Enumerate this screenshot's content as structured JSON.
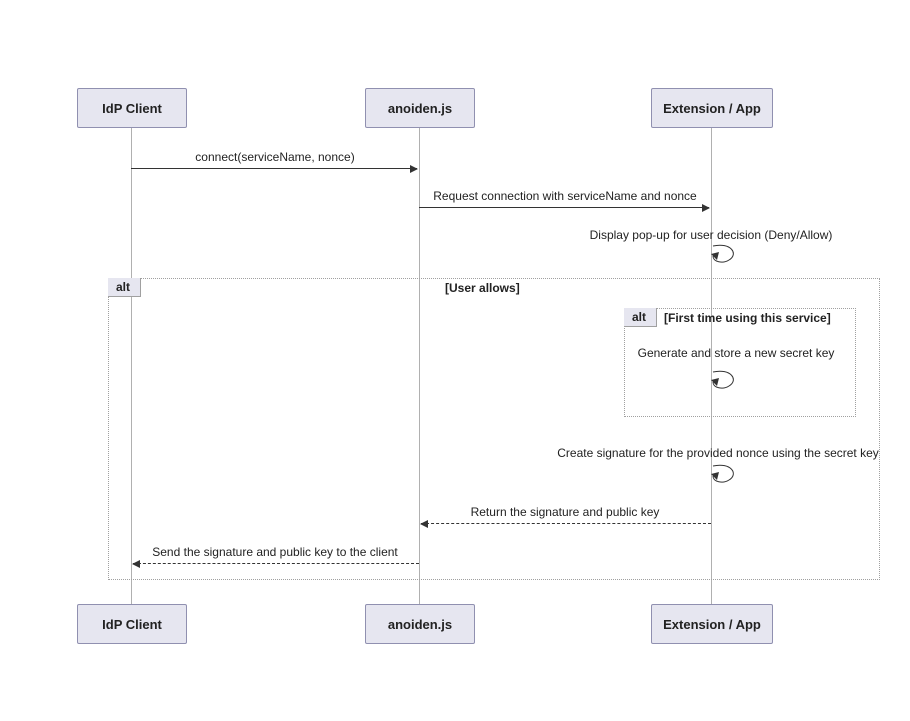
{
  "participants": {
    "p1": "IdP Client",
    "p2": "anoiden.js",
    "p3": "Extension / App"
  },
  "messages": {
    "m1": "connect(serviceName, nonce)",
    "m2": "Request connection with serviceName and nonce",
    "m3": "Display pop-up for user decision (Deny/Allow)",
    "m4": "Generate and store a new secret key",
    "m5": "Create signature for the provided nonce using the secret key",
    "m6": "Return the signature and public key",
    "m7": "Send the signature and public key to the client"
  },
  "alt": {
    "outer_label": "alt",
    "outer_cond": "[User allows]",
    "inner_label": "alt",
    "inner_cond": "[First time using this service]"
  },
  "chart_data": {
    "type": "sequence_diagram",
    "participants": [
      "IdP Client",
      "anoiden.js",
      "Extension / App"
    ],
    "messages": [
      {
        "from": "IdP Client",
        "to": "anoiden.js",
        "text": "connect(serviceName, nonce)",
        "style": "solid"
      },
      {
        "from": "anoiden.js",
        "to": "Extension / App",
        "text": "Request connection with serviceName and nonce",
        "style": "solid"
      },
      {
        "from": "Extension / App",
        "to": "Extension / App",
        "text": "Display pop-up for user decision (Deny/Allow)",
        "style": "self"
      },
      {
        "from": "Extension / App",
        "to": "Extension / App",
        "text": "Generate and store a new secret key",
        "style": "self",
        "fragment": "alt",
        "guard": "[First time using this service]"
      },
      {
        "from": "Extension / App",
        "to": "Extension / App",
        "text": "Create signature for the provided nonce using the secret key",
        "style": "self"
      },
      {
        "from": "Extension / App",
        "to": "anoiden.js",
        "text": "Return the signature and public key",
        "style": "dashed"
      },
      {
        "from": "anoiden.js",
        "to": "IdP Client",
        "text": "Send the signature and public key to the client",
        "style": "dashed"
      }
    ],
    "fragments": [
      {
        "type": "alt",
        "guard": "[User allows]",
        "contains": [
          {
            "type": "alt",
            "guard": "[First time using this service]",
            "messages": [
              "Generate and store a new secret key"
            ]
          },
          "Create signature for the provided nonce using the secret key",
          "Return the signature and public key",
          "Send the signature and public key to the client"
        ]
      }
    ]
  }
}
